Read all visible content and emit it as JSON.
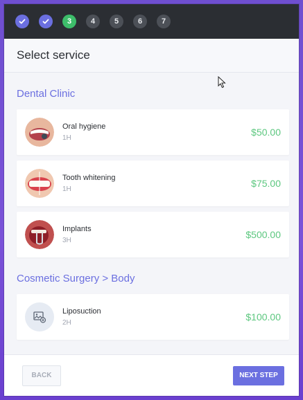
{
  "steps": [
    {
      "label": "",
      "state": "done",
      "icon": "check-icon"
    },
    {
      "label": "",
      "state": "done",
      "icon": "check-icon"
    },
    {
      "label": "3",
      "state": "active"
    },
    {
      "label": "4",
      "state": "todo"
    },
    {
      "label": "5",
      "state": "todo"
    },
    {
      "label": "6",
      "state": "todo"
    },
    {
      "label": "7",
      "state": "todo"
    }
  ],
  "header": {
    "title": "Select service"
  },
  "categories": [
    {
      "name": "Dental Clinic",
      "services": [
        {
          "name": "Oral hygiene",
          "duration": "1H",
          "price": "$50.00",
          "image": "oral-hygiene-photo"
        },
        {
          "name": "Tooth whitening",
          "duration": "1H",
          "price": "$75.00",
          "image": "tooth-whitening-photo"
        },
        {
          "name": "Implants",
          "duration": "3H",
          "price": "$500.00",
          "image": "implants-photo"
        }
      ]
    },
    {
      "name": "Cosmetic Surgery > Body",
      "services": [
        {
          "name": "Liposuction",
          "duration": "2H",
          "price": "$100.00",
          "image": "image-placeholder-icon"
        }
      ]
    }
  ],
  "footer": {
    "back_label": "BACK",
    "next_label": "NEXT STEP"
  },
  "colors": {
    "accent": "#6b6fe0",
    "active_step": "#3dbd6a",
    "price": "#5cc77f",
    "stepbar_bg": "#2b2e33"
  }
}
